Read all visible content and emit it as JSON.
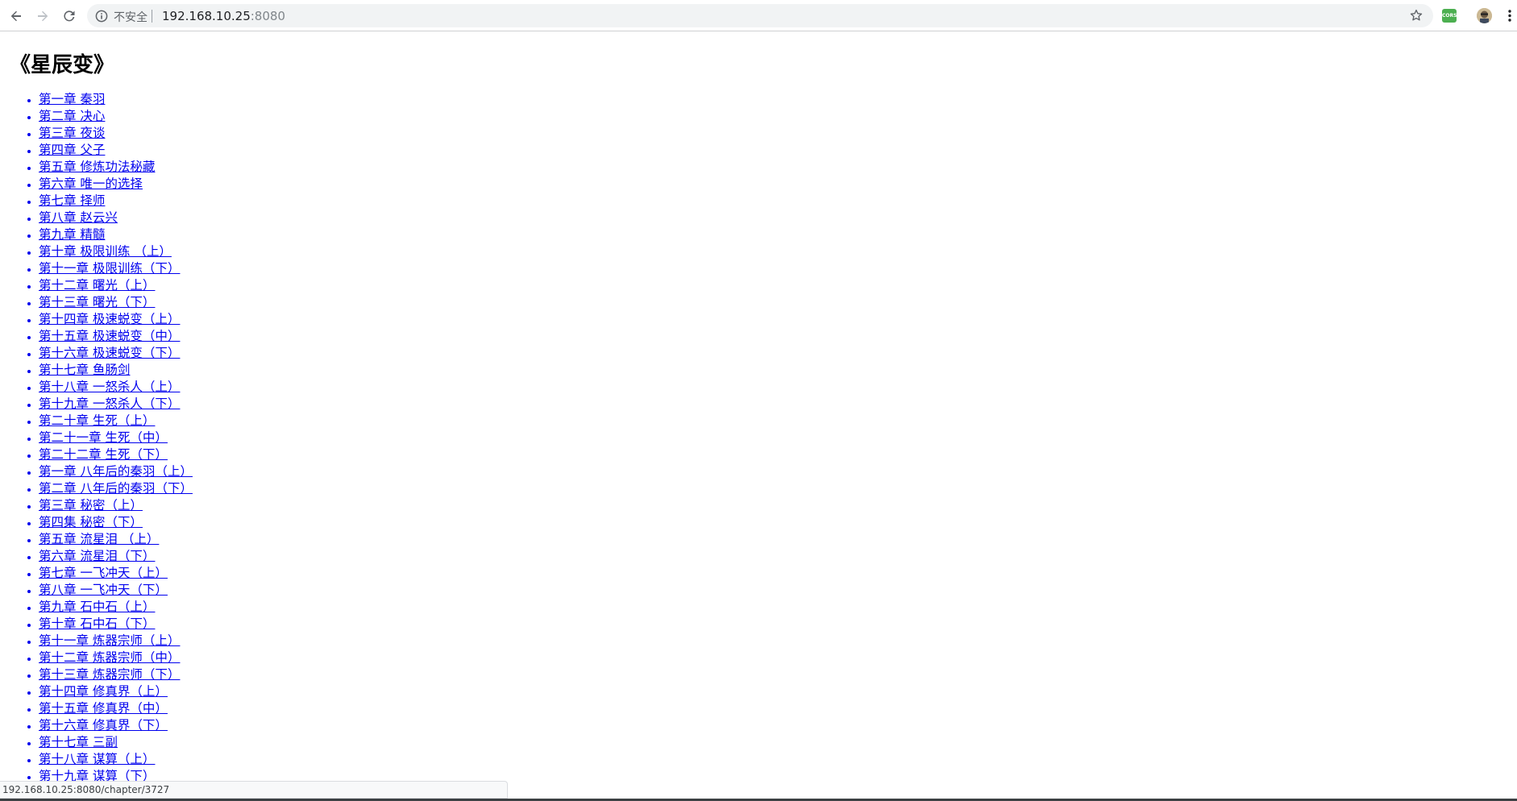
{
  "browser": {
    "security_label": "不安全",
    "url_host": "192.168.10.25",
    "url_port": ":8080",
    "extension_label": "CORS"
  },
  "page": {
    "title": "《星辰变》",
    "chapters": [
      "第一章 秦羽",
      "第二章 决心",
      "第三章 夜谈",
      "第四章 父子",
      "第五章 修炼功法秘藏",
      "第六章 唯一的选择",
      "第七章 择师",
      "第八章 赵云兴",
      "第九章 精髓",
      "第十章 极限训练 （上）",
      "第十一章 极限训练（下）",
      "第十二章 曙光（上）",
      "第十三章 曙光（下）",
      "第十四章 极速蜕变（上）",
      "第十五章 极速蜕变（中）",
      "第十六章 极速蜕变（下）",
      "第十七章 鱼肠剑",
      "第十八章 一怒杀人（上）",
      "第十九章 一怒杀人（下）",
      "第二十章 生死（上）",
      "第二十一章 生死（中）",
      "第二十二章 生死（下）",
      "第一章 八年后的秦羽（上）",
      "第二章 八年后的秦羽（下）",
      "第三章 秘密（上）",
      "第四集 秘密（下）",
      "第五章 流星泪 （上）",
      "第六章 流星泪（下）",
      "第七章 一飞冲天（上）",
      "第八章 一飞冲天（下）",
      "第九章 石中石（上）",
      "第十章 石中石（下）",
      "第十一章 炼器宗师（上）",
      "第十二章 炼器宗师（中）",
      "第十三章 炼器宗师（下）",
      "第十四章 修真界（上）",
      "第十五章 修真界（中）",
      "第十六章 修真界（下）",
      "第十七章 三副",
      "第十八章 谋算（上）",
      "第十九章 谋算（下）"
    ]
  },
  "status_bar": {
    "hover_url": "192.168.10.25:8080/chapter/3727"
  },
  "icons": {
    "back": "back-arrow-icon",
    "forward": "forward-arrow-icon",
    "reload": "reload-icon",
    "info": "info-icon",
    "star": "star-icon",
    "menu": "kebab-menu-icon"
  },
  "colors": {
    "link": "#0000ee",
    "omnibox_bg": "#f1f3f4",
    "extension_bg": "#4caf50"
  }
}
